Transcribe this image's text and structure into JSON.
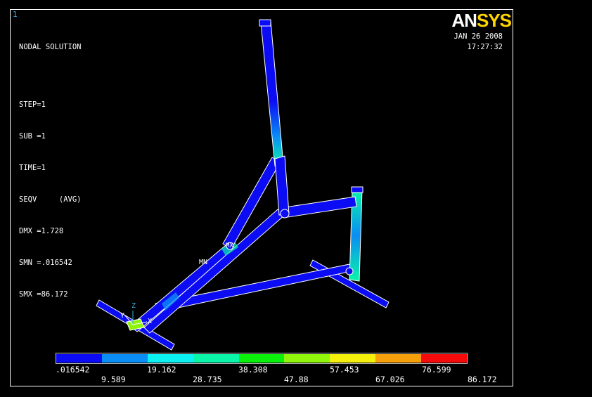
{
  "window_number": "1",
  "title": "NODAL SOLUTION",
  "solution_info": {
    "step": "STEP=1",
    "sub": "SUB =1",
    "time": "TIME=1",
    "seqv": "SEQV     (AVG)",
    "dmx": "DMX =1.728",
    "smn": "SMN =.016542",
    "smx": "SMX =86.172"
  },
  "logo": {
    "an": "AN",
    "sys": "SYS"
  },
  "date": "JAN 26 2008",
  "time_of_day": "17:27:32",
  "annotations": {
    "mn": "MN",
    "mx": "MX"
  },
  "triad": {
    "x": "X",
    "y": "Y",
    "z": "Z"
  },
  "legend": {
    "colors": [
      "#0b0cf4",
      "#0a8df5",
      "#0bf0f0",
      "#0af5a8",
      "#0af00b",
      "#8ef50b",
      "#f5f00b",
      "#f5a00b",
      "#f50b0b"
    ],
    "labels_top": [
      ".016542",
      "19.162",
      "38.308",
      "57.453",
      "76.599"
    ],
    "labels_bottom": [
      "9.589",
      "28.735",
      "47.88",
      "67.026",
      "86.172"
    ]
  }
}
